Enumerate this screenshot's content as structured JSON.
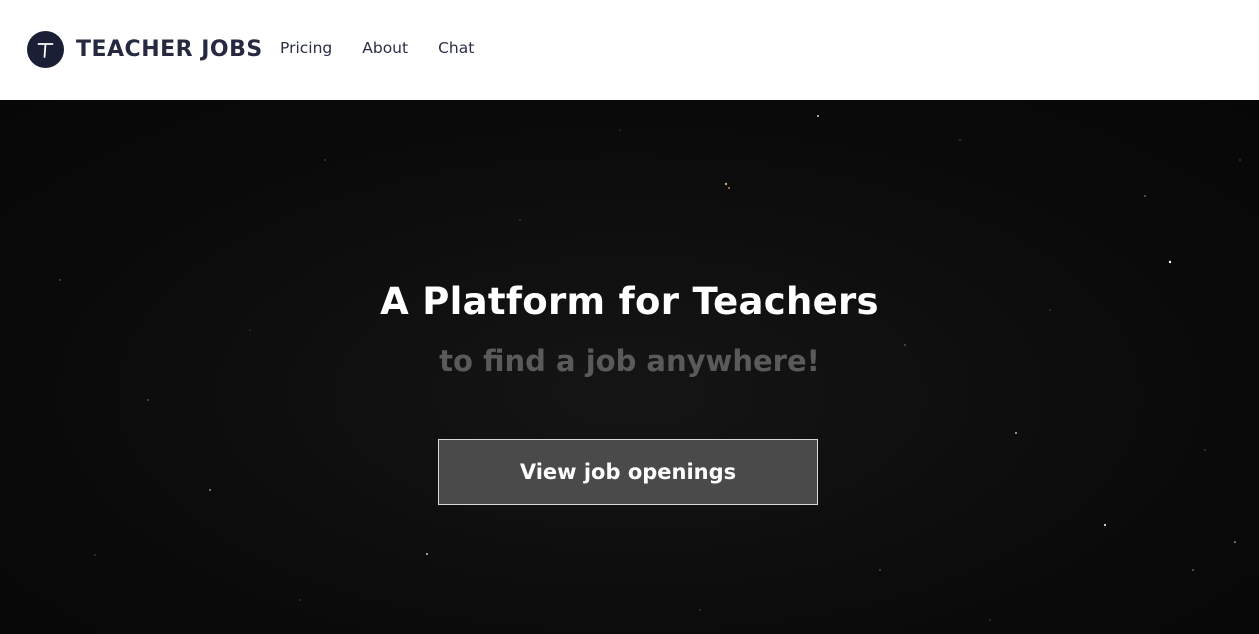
{
  "header": {
    "brand": {
      "logo_letter": "T",
      "name": "TEACHER JOBS"
    },
    "nav": [
      {
        "label": "Pricing"
      },
      {
        "label": "About"
      },
      {
        "label": "Chat"
      }
    ]
  },
  "hero": {
    "title": "A Platform for Teachers",
    "subtitle": "to find a job anywhere!",
    "cta_label": "View job openings"
  },
  "colors": {
    "brand_dark": "#1b1f36",
    "hero_background": "#0b0b0b",
    "subtitle": "#5a5a5a",
    "button_fill": "#4a4a4a",
    "button_border": "#d8d8d8"
  }
}
